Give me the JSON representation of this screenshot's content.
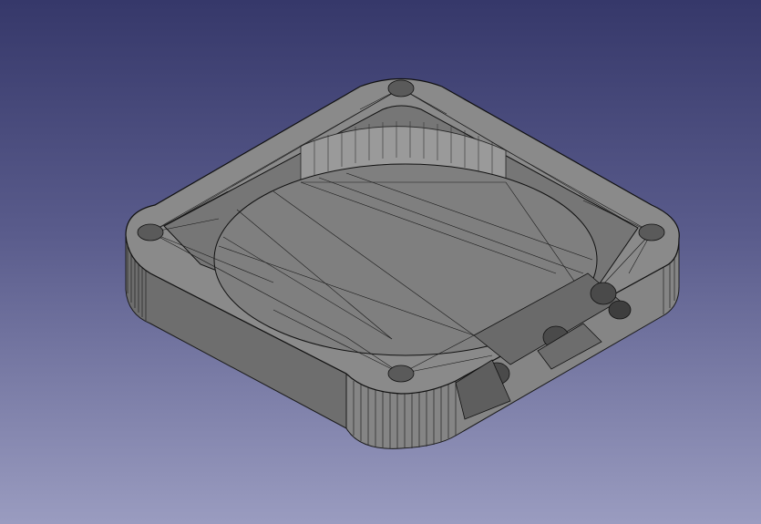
{
  "viewport": {
    "background_top": "#36386a",
    "background_bottom": "#9a9cc0"
  },
  "model": {
    "shape": "rounded square tray with recessed circular pocket (mesh wireframe view)",
    "fill_color": "#7b7b7b",
    "edge_color": "#111111"
  }
}
